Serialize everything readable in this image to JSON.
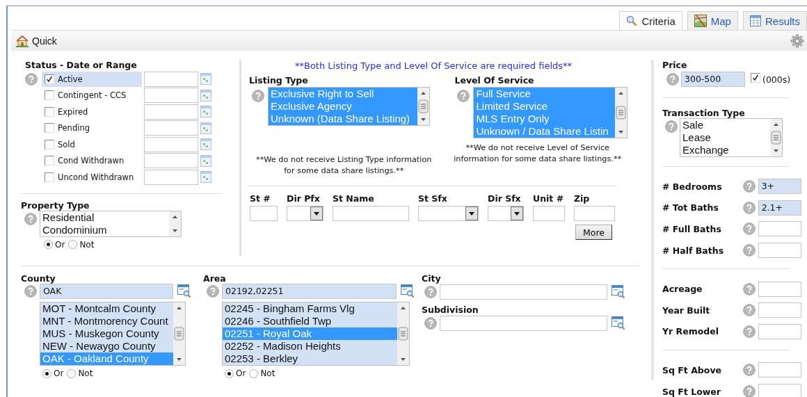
{
  "tabs": [
    {
      "label": "Criteria",
      "kind": "search",
      "selected": true
    },
    {
      "label": "Map",
      "kind": "map",
      "selected": false
    },
    {
      "label": "Results",
      "kind": "table",
      "selected": false
    }
  ],
  "toolbar": {
    "quick": "Quick"
  },
  "status": {
    "title": "Status - Date or Range",
    "items": [
      {
        "label": "Active",
        "checked": true
      },
      {
        "label": "Contingent - CCS",
        "checked": false
      },
      {
        "label": "Expired",
        "checked": false
      },
      {
        "label": "Pending",
        "checked": false
      },
      {
        "label": "Sold",
        "checked": false
      },
      {
        "label": "Cond Withdrawn",
        "checked": false
      },
      {
        "label": "Uncond Withdrawn",
        "checked": false
      }
    ]
  },
  "property_type": {
    "title": "Property Type",
    "options": [
      {
        "label": "Residential",
        "selected": false
      },
      {
        "label": "Condominium",
        "selected": false
      }
    ],
    "mode": [
      {
        "label": "Or",
        "selected": true
      },
      {
        "label": "Not",
        "selected": false
      }
    ]
  },
  "notice": "**Both Listing Type and Level Of Service are required fields**",
  "listing_type": {
    "title": "Listing Type",
    "options": [
      {
        "label": "Exclusive Right to Sell",
        "selected": true
      },
      {
        "label": "Exclusive Agency",
        "selected": true
      },
      {
        "label": "Unknown (Data Share Listing)",
        "selected": true
      }
    ],
    "note": "**We do not receive Listing Type information for some data share listings.**"
  },
  "level_of_service": {
    "title": "Level Of Service",
    "options": [
      {
        "label": "Full Service",
        "selected": true
      },
      {
        "label": "Limited Service",
        "selected": true
      },
      {
        "label": "MLS Entry Only",
        "selected": true
      },
      {
        "label": "Unknown / Data Share Listin",
        "selected": true
      }
    ],
    "note": "**We do not receive Level of Service information for some data share listings.**"
  },
  "address": {
    "fields": [
      {
        "label": "St #",
        "kind": "text"
      },
      {
        "label": "Dir Pfx",
        "kind": "select"
      },
      {
        "label": "St Name",
        "kind": "text"
      },
      {
        "label": "St Sfx",
        "kind": "select"
      },
      {
        "label": "Dir Sfx",
        "kind": "select"
      },
      {
        "label": "Unit #",
        "kind": "text"
      },
      {
        "label": "Zip",
        "kind": "text"
      }
    ],
    "more_button": "More"
  },
  "county": {
    "title": "County",
    "value": "OAK",
    "options": [
      {
        "label": "MOT - Montcalm County",
        "selected": false
      },
      {
        "label": "MNT - Montmorency Count",
        "selected": false
      },
      {
        "label": "MUS - Muskegon County",
        "selected": false
      },
      {
        "label": "NEW - Newaygo County",
        "selected": false
      },
      {
        "label": "OAK - Oakland County",
        "selected": true
      }
    ],
    "mode": [
      {
        "label": "Or",
        "selected": true
      },
      {
        "label": "Not",
        "selected": false
      }
    ]
  },
  "area": {
    "title": "Area",
    "value": "02192,02251",
    "options": [
      {
        "label": "02245 - Bingham Farms Vlg",
        "selected": false
      },
      {
        "label": "02246 - Southfield Twp",
        "selected": false
      },
      {
        "label": "02251 - Royal Oak",
        "selected": true
      },
      {
        "label": "02252 - Madison Heights",
        "selected": false
      },
      {
        "label": "02253 - Berkley",
        "selected": false
      }
    ],
    "mode": [
      {
        "label": "Or",
        "selected": true
      },
      {
        "label": "Not",
        "selected": false
      }
    ]
  },
  "city": {
    "title": "City"
  },
  "subdivision": {
    "title": "Subdivision"
  },
  "price": {
    "title": "Price",
    "value": "300-500",
    "thousands": {
      "label": "(000s)",
      "checked": true
    }
  },
  "transaction_type": {
    "title": "Transaction Type",
    "options": [
      {
        "label": "Sale",
        "selected": false
      },
      {
        "label": "Lease",
        "selected": false
      },
      {
        "label": "Exchange",
        "selected": false
      }
    ]
  },
  "counts": [
    [
      {
        "label": "# Bedrooms",
        "value": "3+"
      },
      {
        "label": "# Tot Baths",
        "value": "2.1+"
      },
      {
        "label": "# Full Baths"
      },
      {
        "label": "# Half Baths"
      }
    ],
    [
      {
        "label": "Acreage"
      },
      {
        "label": "Year Built"
      },
      {
        "label": "Yr Remodel"
      }
    ],
    [
      {
        "label": "Sq Ft Above"
      },
      {
        "label": "Sq Ft Lower"
      }
    ]
  ]
}
